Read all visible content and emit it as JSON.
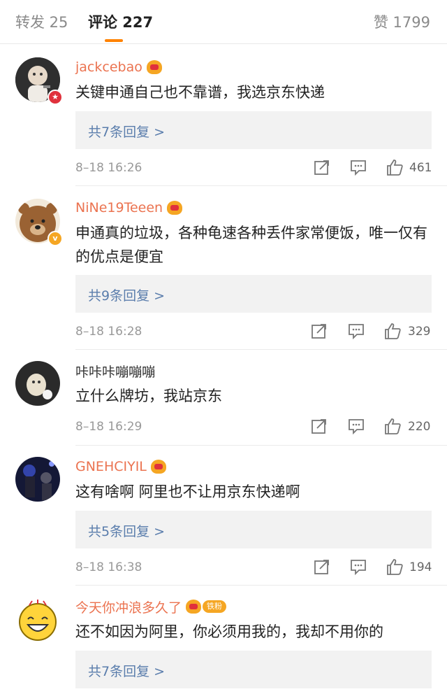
{
  "tabs": {
    "repost": "转发 25",
    "comment": "评论 227",
    "like": "赞 1799"
  },
  "comments": [
    {
      "user": "jackcebao",
      "text": "关键申通自己也不靠谱，我选京东快递",
      "reply": "共7条回复 >",
      "time": "8–18 16:26",
      "likes": "461"
    },
    {
      "user": "NiNe19Teeen",
      "text": "申通真的垃圾，各种龟速各种丢件家常便饭，唯一仅有的优点是便宜",
      "reply": "共9条回复 >",
      "time": "8–18 16:28",
      "likes": "329"
    },
    {
      "user": "咔咔咔嘣嘣嘣",
      "text": "立什么牌坊，我站京东",
      "time": "8–18 16:29",
      "likes": "220"
    },
    {
      "user": "GNEHCIYIL",
      "text": "这有啥啊 阿里也不让用京东快递啊",
      "reply": "共5条回复 >",
      "time": "8–18 16:38",
      "likes": "194"
    },
    {
      "user": "今天你冲浪多久了",
      "badge": "铁粉",
      "text": "还不如因为阿里，你必须用我的，我却不用你的",
      "reply": "共7条回复 >"
    }
  ],
  "colors": {
    "accent": "#ff8200",
    "username": "#eb7350",
    "reply_link": "#5a7dac"
  },
  "icons": [
    "share-icon",
    "comment-icon",
    "like-icon",
    "crown-icon",
    "verified-icon"
  ]
}
